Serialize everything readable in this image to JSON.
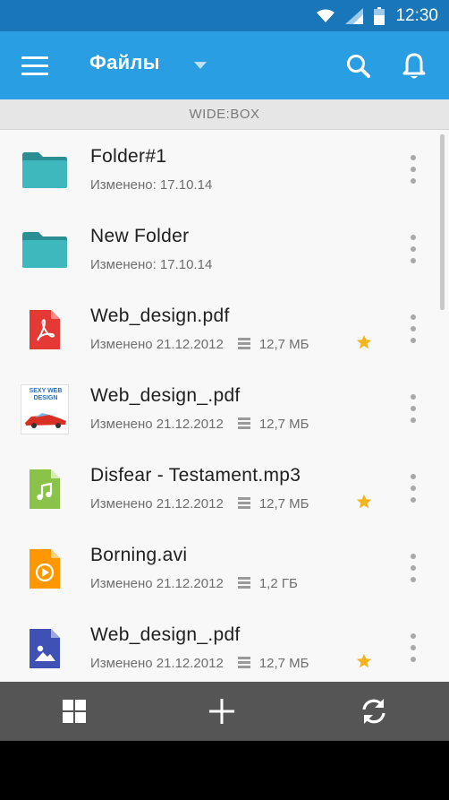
{
  "status_bar": {
    "time": "12:30",
    "icons": [
      "wifi-icon",
      "signal-icon",
      "battery-icon"
    ]
  },
  "app_bar": {
    "title": "Файлы",
    "icons": [
      "menu-icon",
      "dropdown-icon",
      "search-icon",
      "bell-icon"
    ],
    "color": "#2a9ee3"
  },
  "section": {
    "label": "WIDE:BOX"
  },
  "files": [
    {
      "name": "Folder#1",
      "modified": "Изменено: 17.10.14",
      "size": "",
      "starred": false,
      "type": "folder"
    },
    {
      "name": "New Folder",
      "modified": "Изменено: 17.10.14",
      "size": "",
      "starred": false,
      "type": "folder"
    },
    {
      "name": "Web_design.pdf",
      "modified": "Изменено 21.12.2012",
      "size": "12,7 МБ",
      "starred": true,
      "type": "pdf"
    },
    {
      "name": "Web_design_.pdf",
      "modified": "Изменено 21.12.2012",
      "size": "12,7 МБ",
      "starred": false,
      "type": "thumbnail",
      "thumb_text": "SEXY WEB DESIGN"
    },
    {
      "name": "Disfear - Testament.mp3",
      "modified": "Изменено 21.12.2012",
      "size": "12,7 МБ",
      "starred": true,
      "type": "audio"
    },
    {
      "name": "Borning.avi",
      "modified": "Изменено 21.12.2012",
      "size": "1,2 ГБ",
      "starred": false,
      "type": "video"
    },
    {
      "name": "Web_design_.pdf",
      "modified": "Изменено 21.12.2012",
      "size": "12,7 МБ",
      "starred": true,
      "type": "image"
    }
  ],
  "bottom_bar": {
    "buttons": [
      "grid-view-icon",
      "add-icon",
      "sync-icon"
    ]
  },
  "colors": {
    "status_bar": "#1976b8",
    "accent": "#2a9ee3",
    "folder": "#3fb8bd",
    "pdf": "#e53935",
    "audio": "#8bc34a",
    "video": "#ff9800",
    "image": "#3f51b5",
    "star": "#f5b31c",
    "bottom_bar": "#555555"
  }
}
